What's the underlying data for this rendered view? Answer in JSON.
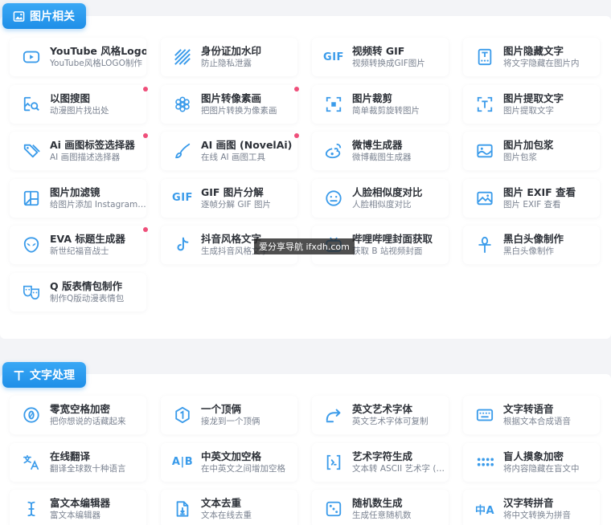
{
  "sections": [
    {
      "title": "图片相关",
      "icon": "image-icon",
      "items": [
        {
          "title": "YouTube 风格Logo",
          "desc": "YouTube风格LOGO制作",
          "icon": "youtube-play-icon"
        },
        {
          "title": "身份证加水印",
          "desc": "防止隐私泄露",
          "icon": "diagonal-stripes-icon"
        },
        {
          "title": "视频转 GIF",
          "desc": "视频转换成GIF图片",
          "icon": "gif-icon",
          "glyph": "GIF"
        },
        {
          "title": "图片隐藏文字",
          "desc": "将文字隐藏在图片内",
          "icon": "hidden-text-icon"
        },
        {
          "title": "以图搜图",
          "desc": "动漫图片找出处",
          "icon": "image-search-icon",
          "badge": true
        },
        {
          "title": "图片转像素画",
          "desc": "把图片转换为像素画",
          "icon": "flower-icon",
          "badge": true
        },
        {
          "title": "图片裁剪",
          "desc": "简单裁剪旋转图片",
          "icon": "crop-icon"
        },
        {
          "title": "图片提取文字",
          "desc": "图片提取文字",
          "icon": "text-scan-icon"
        },
        {
          "title": "Ai 画图标签选择器",
          "desc": "AI 画图描述选择器",
          "icon": "tags-icon",
          "badge": true
        },
        {
          "title": "AI 画图 (NovelAi)",
          "desc": "在线 AI 画图工具",
          "icon": "brush-icon",
          "badge": true
        },
        {
          "title": "微博生成器",
          "desc": "微博截图生成器",
          "icon": "weibo-icon"
        },
        {
          "title": "图片加包浆",
          "desc": "图片包浆",
          "icon": "image-wave-icon"
        },
        {
          "title": "图片加滤镜",
          "desc": "给图片添加 Instagram…",
          "icon": "filter-layout-icon"
        },
        {
          "title": "GIF 图片分解",
          "desc": "逐帧分解 GIF 图片",
          "icon": "gif-icon",
          "glyph": "GIF"
        },
        {
          "title": "人脸相似度对比",
          "desc": "人脸相似度对比",
          "icon": "face-icon"
        },
        {
          "title": "图片 EXIF 查看",
          "desc": "图片 EXIF 查看",
          "icon": "image-info-icon"
        },
        {
          "title": "EVA 标题生成器",
          "desc": "新世纪福音战士",
          "icon": "alien-icon",
          "badge": true
        },
        {
          "title": "抖音风格文字",
          "desc": "生成抖音风格文字",
          "icon": "tiktok-icon"
        },
        {
          "title": "哔哩哔哩封面获取",
          "desc": "获取 B 站视频封面",
          "icon": "bilibili-icon"
        },
        {
          "title": "黑白头像制作",
          "desc": "黑白头像制作",
          "icon": "ankh-icon"
        },
        {
          "title": "Q 版表情包制作",
          "desc": "制作Q版动漫表情包",
          "icon": "masks-icon"
        }
      ]
    },
    {
      "title": "文字处理",
      "icon": "text-t-icon",
      "items": [
        {
          "title": "零宽空格加密",
          "desc": "把你想说的话藏起来",
          "icon": "zero-circle-icon"
        },
        {
          "title": "一个顶俩",
          "desc": "接龙到一个顶俩",
          "icon": "hexagon-one-icon"
        },
        {
          "title": "英文艺术字体",
          "desc": "英文艺术字体可复制",
          "icon": "redo-arrow-icon"
        },
        {
          "title": "文字转语音",
          "desc": "根据文本合成语音",
          "icon": "keyboard-icon"
        },
        {
          "title": "在线翻译",
          "desc": "翻译全球数十种语言",
          "icon": "translate-icon"
        },
        {
          "title": "中英文加空格",
          "desc": "在中英文之间增加空格",
          "icon": "spacing-icon",
          "glyph": "A|B"
        },
        {
          "title": "艺术字符生成",
          "desc": "文本转 ASCII 艺术字 (…",
          "icon": "code-brackets-icon"
        },
        {
          "title": "盲人摸象加密",
          "desc": "将内容隐藏在盲文中",
          "icon": "braille-icon"
        },
        {
          "title": "富文本编辑器",
          "desc": "富文本编辑器",
          "icon": "text-cursor-icon"
        },
        {
          "title": "文本去重",
          "desc": "文本在线去重",
          "icon": "file-sort-icon"
        },
        {
          "title": "随机数生成",
          "desc": "生成任意随机数",
          "icon": "dice-icon"
        },
        {
          "title": "汉字转拼音",
          "desc": "将中文转换为拼音",
          "icon": "pinyin-icon",
          "glyph": "中A"
        }
      ]
    }
  ],
  "watermark": "爱分享导航 ifxdh.com",
  "colors": {
    "accent": "#1f8fe8",
    "icon": "#3a9bea",
    "badge": "#ef4f7a"
  }
}
